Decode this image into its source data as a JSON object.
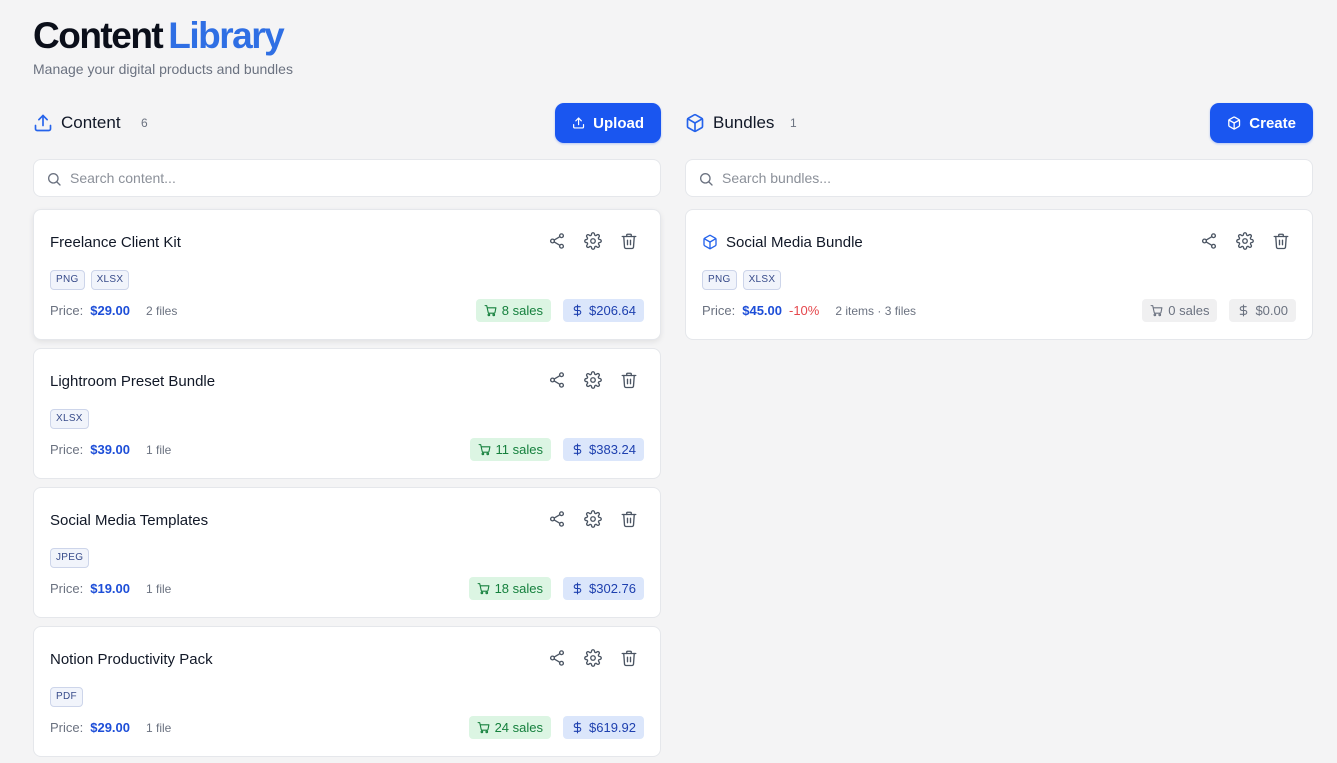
{
  "header": {
    "title_part1": "Content",
    "title_part2": "Library",
    "subtitle": "Manage your digital products and bundles"
  },
  "content": {
    "title": "Content",
    "count": "6",
    "button_label": "Upload",
    "search_placeholder": "Search content...",
    "items": [
      {
        "title": "Freelance Client Kit",
        "tags": [
          "PNG",
          "XLSX"
        ],
        "price_label": "Price:",
        "price": "$29.00",
        "files": "2 files",
        "sales": "8 sales",
        "revenue": "$206.64"
      },
      {
        "title": "Lightroom Preset Bundle",
        "tags": [
          "XLSX"
        ],
        "price_label": "Price:",
        "price": "$39.00",
        "files": "1 file",
        "sales": "11 sales",
        "revenue": "$383.24"
      },
      {
        "title": "Social Media Templates",
        "tags": [
          "JPEG"
        ],
        "price_label": "Price:",
        "price": "$19.00",
        "files": "1 file",
        "sales": "18 sales",
        "revenue": "$302.76"
      },
      {
        "title": "Notion Productivity Pack",
        "tags": [
          "PDF"
        ],
        "price_label": "Price:",
        "price": "$29.00",
        "files": "1 file",
        "sales": "24 sales",
        "revenue": "$619.92"
      }
    ]
  },
  "bundles": {
    "title": "Bundles",
    "count": "1",
    "button_label": "Create",
    "search_placeholder": "Search bundles...",
    "items": [
      {
        "title": "Social Media Bundle",
        "tags": [
          "PNG",
          "XLSX"
        ],
        "price_label": "Price:",
        "price": "$45.00",
        "discount": "-10%",
        "files": "2 items · 3 files",
        "sales": "0 sales",
        "revenue": "$0.00"
      }
    ]
  },
  "colors": {
    "accent": "#1a56f0",
    "brand_blue": "#2f6fe4",
    "sales_bg": "#dcf5e3",
    "revenue_bg": "#dbe6fb",
    "discount": "#e5484d"
  },
  "icons": {
    "content_section": "upload-icon",
    "bundles_section": "cube-icon",
    "search": "search-icon",
    "actions": [
      "share-icon",
      "gear-icon",
      "trash-icon"
    ],
    "sales": "cart-icon",
    "revenue": "dollar-icon"
  }
}
